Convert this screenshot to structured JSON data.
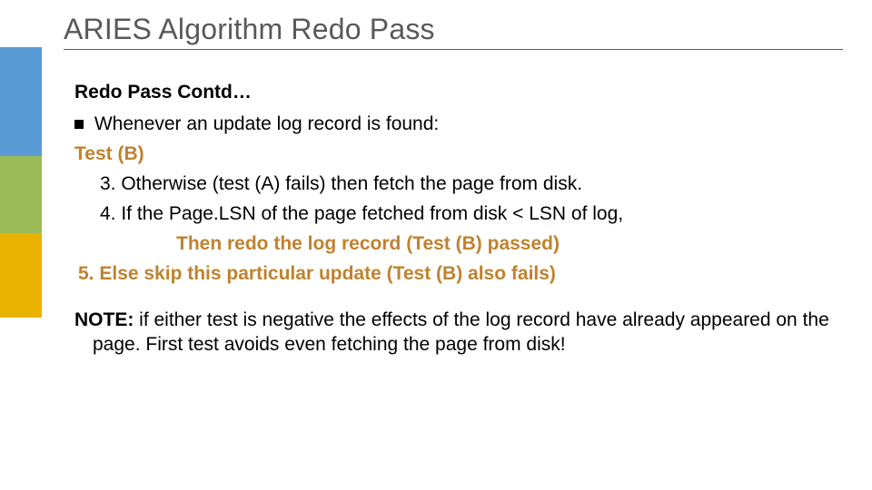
{
  "title": "ARIES Algorithm Redo Pass",
  "subheading": "Redo Pass Contd…",
  "bullet_line": " Whenever an update log record is found:",
  "test_label": "Test (B)",
  "step3": "3. Otherwise (test (A) fails) then fetch the page from disk.",
  "step4": "4. If the Page.LSN of the page fetched from disk < LSN of log,",
  "then_line": "Then redo the log record (Test (B) passed)",
  "step5": "5. Else skip this particular update (Test (B) also fails)",
  "note_label": "NOTE:",
  "note_text": " if either test is negative the effects of the log record have already appeared on the page.  First test avoids even fetching the page from disk!"
}
